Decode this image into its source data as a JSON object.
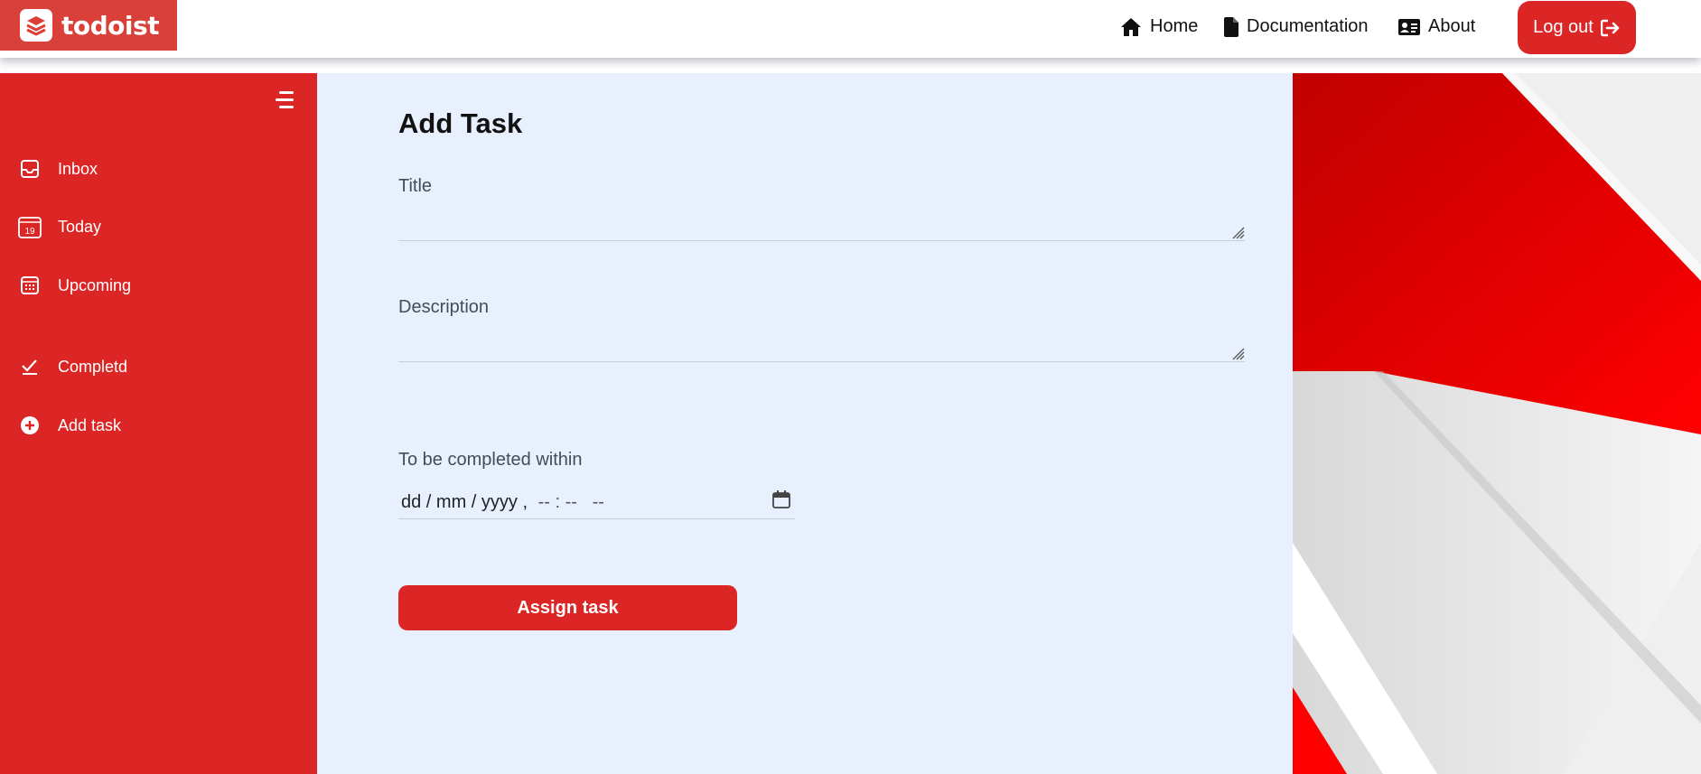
{
  "brand": {
    "name": "todoist"
  },
  "nav": {
    "home": "Home",
    "documentation": "Documentation",
    "about": "About",
    "logout": "Log out"
  },
  "sidebar": {
    "items": [
      {
        "label": "Inbox",
        "icon": "inbox-icon"
      },
      {
        "label": "Today",
        "icon": "calendar-day-icon",
        "badge": "19"
      },
      {
        "label": "Upcoming",
        "icon": "calendar-grid-icon"
      },
      {
        "label": "Completd",
        "icon": "checkmark-icon"
      },
      {
        "label": "Add task",
        "icon": "plus-circle-icon"
      }
    ]
  },
  "form": {
    "heading": "Add Task",
    "title_label": "Title",
    "title_value": "",
    "description_label": "Description",
    "description_value": "",
    "deadline_label": "To be completed within",
    "deadline_date_placeholder": "dd / mm / yyyy ,",
    "deadline_time_placeholder": " -- : --   --",
    "submit_label": "Assign task"
  },
  "colors": {
    "accent": "#dc2626",
    "logo_bg": "#d9403a",
    "main_bg": "#e8f0fd"
  }
}
